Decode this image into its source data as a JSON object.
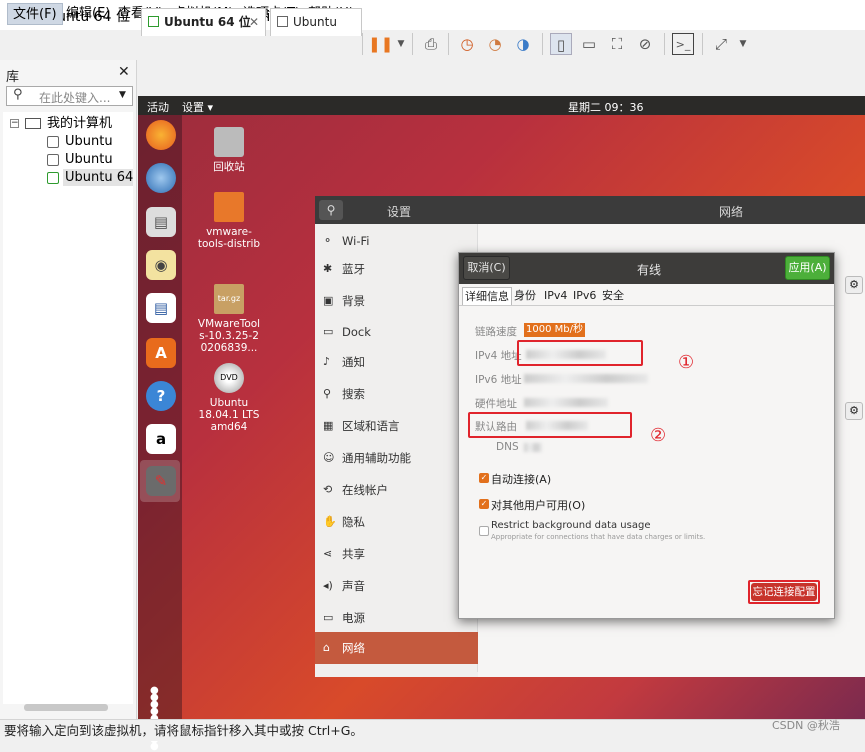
{
  "window": {
    "title": "Ubuntu 64 位 - VMware Workstation"
  },
  "menu": [
    "文件(F)",
    "编辑(E)",
    "查看(V)",
    "虚拟机(M)",
    "选项卡(T)",
    "帮助(H)"
  ],
  "library": {
    "title": "库",
    "search_placeholder": "在此处键入...",
    "root": "我的计算机",
    "vms": [
      "Ubuntu",
      "Ubuntu",
      "Ubuntu 64 位"
    ]
  },
  "tabs": [
    {
      "label": "Ubuntu 64 位"
    },
    {
      "label": "Ubuntu"
    }
  ],
  "guest": {
    "activities": "活动",
    "app_menu": "设置 ▾",
    "clock": "星期二 09：36",
    "desktop_icons": [
      {
        "label": "回收站"
      },
      {
        "label": "vmware-tools-distrib"
      },
      {
        "label": "VMwareTools-10.3.25-20206839..."
      },
      {
        "label": "Ubuntu 18.04.1 LTS amd64"
      }
    ]
  },
  "settings": {
    "title": "设置",
    "panel_title": "网络",
    "sidebar": [
      {
        "icon": "wifi-icon",
        "label": "Wi-Fi"
      },
      {
        "icon": "bluetooth-icon",
        "label": "蓝牙"
      },
      {
        "icon": "background-icon",
        "label": "背景"
      },
      {
        "icon": "dock-icon",
        "label": "Dock"
      },
      {
        "icon": "bell-icon",
        "label": "通知"
      },
      {
        "icon": "search-icon",
        "label": "搜索"
      },
      {
        "icon": "region-icon",
        "label": "区域和语言"
      },
      {
        "icon": "accessibility-icon",
        "label": "通用辅助功能"
      },
      {
        "icon": "online-accounts-icon",
        "label": "在线帐户"
      },
      {
        "icon": "privacy-icon",
        "label": "隐私"
      },
      {
        "icon": "share-icon",
        "label": "共享"
      },
      {
        "icon": "sound-icon",
        "label": "声音"
      },
      {
        "icon": "power-icon",
        "label": "电源"
      },
      {
        "icon": "network-icon",
        "label": "网络"
      }
    ]
  },
  "dialog": {
    "cancel": "取消(C)",
    "title": "有线",
    "apply": "应用(A)",
    "tabs": [
      "详细信息",
      "身份",
      "IPv4",
      "IPv6",
      "安全"
    ],
    "link_speed_label": "链路速度",
    "link_speed_value": "1000 Mb/秒",
    "ipv4_label": "IPv4 地址",
    "ipv6_label": "IPv6 地址",
    "hw_label": "硬件地址",
    "route_label": "默认路由",
    "dns_label": "DNS",
    "auto_connect": "自动连接(A)",
    "all_users": "对其他用户可用(O)",
    "restrict_title": "Restrict background data usage",
    "restrict_sub": "Appropriate for connections that have data charges or limits.",
    "forget": "忘记连接配置"
  },
  "annotations": {
    "one": "①",
    "two": "②"
  },
  "status_bar": "要将输入定向到该虚拟机，请将鼠标指针移入其中或按 Ctrl+G。",
  "watermark": "CSDN @秋浩",
  "colors": {
    "accent": "#e2701c",
    "apply": "#4caf3a",
    "selected": "#c45a3e",
    "annotation": "#e0242c"
  }
}
